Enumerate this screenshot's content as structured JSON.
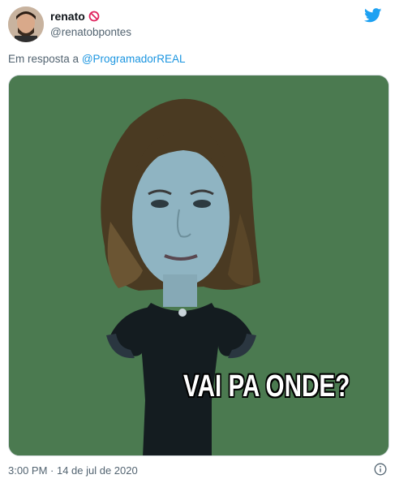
{
  "tweet": {
    "display_name": "renato",
    "handle": "@renatobpontes",
    "reply_prefix": "Em resposta a",
    "reply_to": "@ProgramadorREAL",
    "timestamp": "3:00 PM · 14 de jul de 2020"
  },
  "media": {
    "caption": "VAI PA ONDE?",
    "background_color": "#4b7a50"
  },
  "icons": {
    "name_badge": "no-entry-icon",
    "brand": "twitter-bird-icon",
    "info": "info-icon"
  },
  "colors": {
    "brand_blue": "#1da1f2",
    "link_blue": "#1b95e0",
    "muted_text": "#536471",
    "badge_red": "#e0245e"
  }
}
